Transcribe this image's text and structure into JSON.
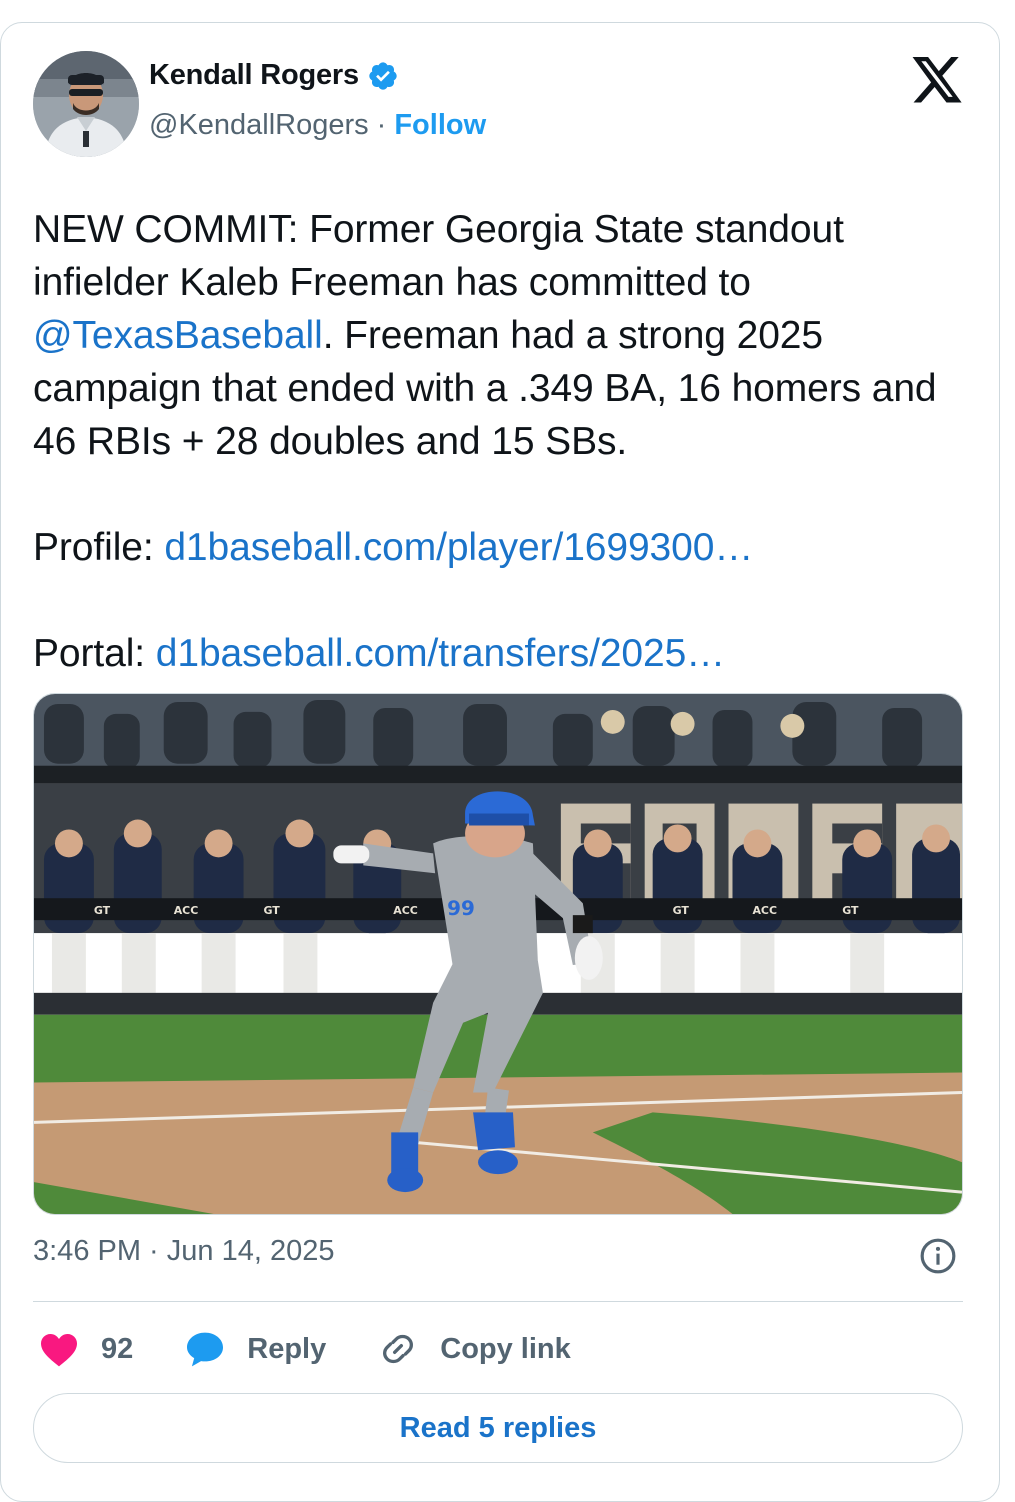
{
  "author": {
    "display_name": "Kendall Rogers",
    "handle": "@KendallRogers",
    "separator": "·",
    "follow_label": "Follow",
    "verified": true,
    "avatar_icon": "profile-photo"
  },
  "brand": {
    "logo_icon": "x-logo"
  },
  "tweet": {
    "line_1": "NEW COMMIT: Former Georgia State standout infielder Kaleb Freeman has committed to ",
    "mention": "@TexasBaseball",
    "line_1_tail": ". Freeman had a strong 2025 campaign that ended with a .349 BA, 16 homers and 46 RBIs + 28 doubles and 15 SBs.",
    "profile_label": "Profile: ",
    "profile_link": "d1baseball.com/player/1699300…",
    "portal_label": "Portal: ",
    "portal_link": "d1baseball.com/transfers/2025…"
  },
  "media": {
    "description_icon": "baseball-photo",
    "jersey_number": "99",
    "wall_letters": "FORGE",
    "sign_texts": [
      "GT",
      "ACC",
      "GT",
      "ACC",
      "GT",
      "ACC",
      "GT"
    ]
  },
  "meta": {
    "timestamp": "3:46 PM · Jun 14, 2025",
    "info_icon": "info-icon"
  },
  "actions": {
    "like_count": "92",
    "reply_label": "Reply",
    "copy_link_label": "Copy link"
  },
  "read_replies_label": "Read 5 replies",
  "colors": {
    "accent": "#1d9bf0",
    "link": "#1a73c9",
    "like": "#f91880",
    "reply_bubble": "#1d9bf0",
    "secondary_text": "#536471",
    "border": "#cfd9de"
  }
}
